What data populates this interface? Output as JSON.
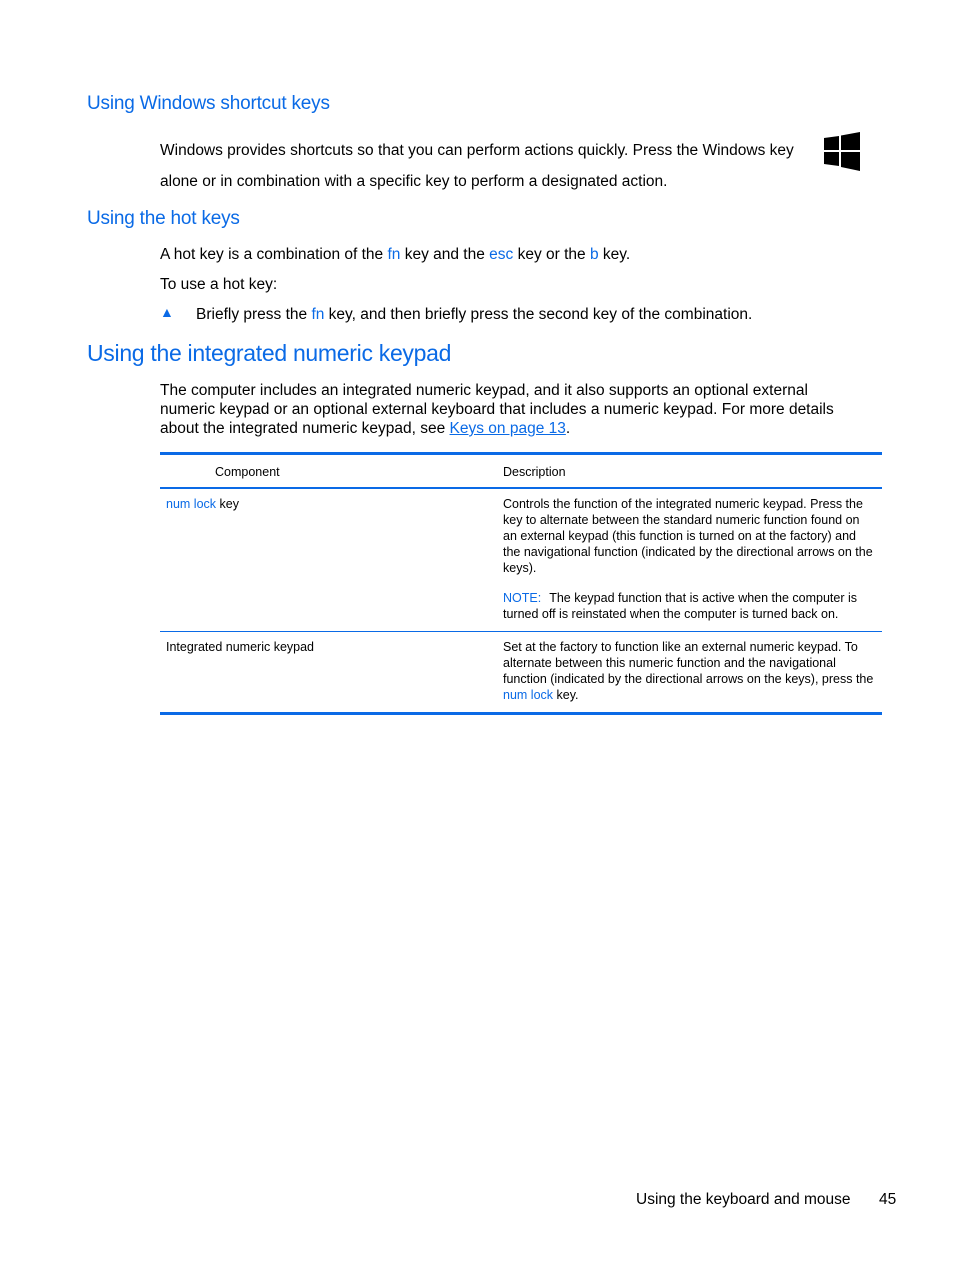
{
  "section1": {
    "heading": "Using Windows shortcut keys",
    "line1": "Windows provides shortcuts so that you can perform actions quickly. Press the Windows key",
    "line2": "alone or in combination with a specific key to perform a designated action."
  },
  "section2": {
    "heading": "Using the hot keys",
    "p1_part1": "A hot key is a combination of the ",
    "p1_key1": "fn",
    "p1_part2": " key and the ",
    "p1_key2": "esc",
    "p1_part3": " key or the ",
    "p1_key3": "b",
    "p1_part4": " key.",
    "p2": "To use a hot key:",
    "bullet_symbol": "▲",
    "bullet_part1": "Briefly press the ",
    "bullet_key": "fn",
    "bullet_part2": " key, and then briefly press the second key of the combination."
  },
  "section3": {
    "heading": "Using the integrated numeric keypad",
    "line1": "The computer includes an integrated numeric keypad, and it also supports an optional external",
    "line2": "numeric keypad or an optional external keyboard that includes a numeric keypad. For more details",
    "line3_part1": "about the integrated numeric keypad, see ",
    "line3_link": "Keys on page 13",
    "line3_part2": "."
  },
  "table": {
    "headers": [
      "Component",
      "Description"
    ],
    "rows": [
      {
        "component_key": "num lock",
        "component_rest": " key",
        "description": "Controls the function of the integrated numeric keypad. Press the key to alternate between the standard numeric function found on an external keypad (this function is turned on at the factory) and the navigational function (indicated by the directional arrows on the keys).",
        "note_label": "NOTE:",
        "note_text": "The keypad function that is active when the computer is turned off is reinstated when the computer is turned back on."
      },
      {
        "component": "Integrated numeric keypad",
        "description_part1": "Set at the factory to function like an external numeric keypad. To alternate between this numeric function and the navigational function (indicated by the directional arrows on the keys), press the ",
        "description_key": "num lock",
        "description_part2": " key."
      }
    ]
  },
  "footer": {
    "chapter": "Using the keyboard and mouse",
    "page": "45"
  },
  "icons": {
    "windows_key": "windows-logo-icon"
  },
  "colors": {
    "accent": "#0a6ae6"
  }
}
